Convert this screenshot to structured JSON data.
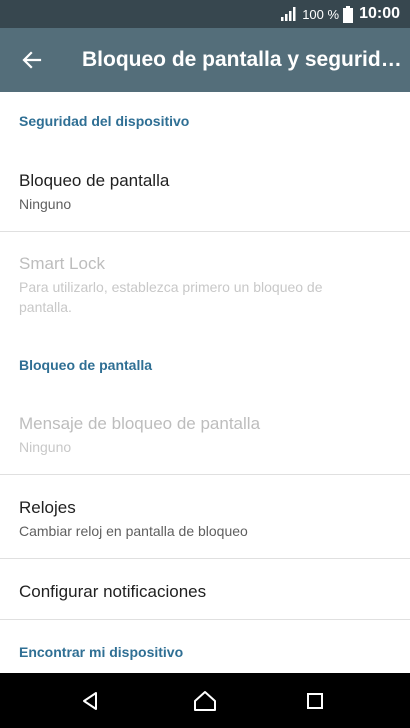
{
  "status_bar": {
    "battery_percent": "100 %",
    "time": "10:00",
    "icons": [
      "signal-icon",
      "battery-icon"
    ]
  },
  "app_bar": {
    "title": "Bloqueo de pantalla y seguridad",
    "back_icon": "arrow-back-icon"
  },
  "sections": {
    "device_security": "Seguridad del dispositivo",
    "lock_screen": "Bloqueo de pantalla",
    "find_device": "Encontrar mi dispositivo"
  },
  "items": {
    "screen_lock": {
      "title": "Bloqueo de pantalla",
      "subtitle": "Ninguno"
    },
    "smart_lock": {
      "title": "Smart Lock",
      "subtitle": "Para utilizarlo, establezca primero un bloqueo de pantalla."
    },
    "lock_message": {
      "title": "Mensaje de bloqueo de pantalla",
      "subtitle": "Ninguno"
    },
    "clocks": {
      "title": "Relojes",
      "subtitle": "Cambiar reloj en pantalla de bloqueo"
    },
    "notifications": {
      "title": "Configurar notificaciones"
    }
  },
  "nav_bar": {
    "icons": [
      "back-triangle-icon",
      "home-icon",
      "recents-icon"
    ]
  },
  "colors": {
    "status_bar": "#37474f",
    "app_bar": "#546e7a",
    "section_header": "#2f6f94",
    "nav_bar": "#000000"
  }
}
